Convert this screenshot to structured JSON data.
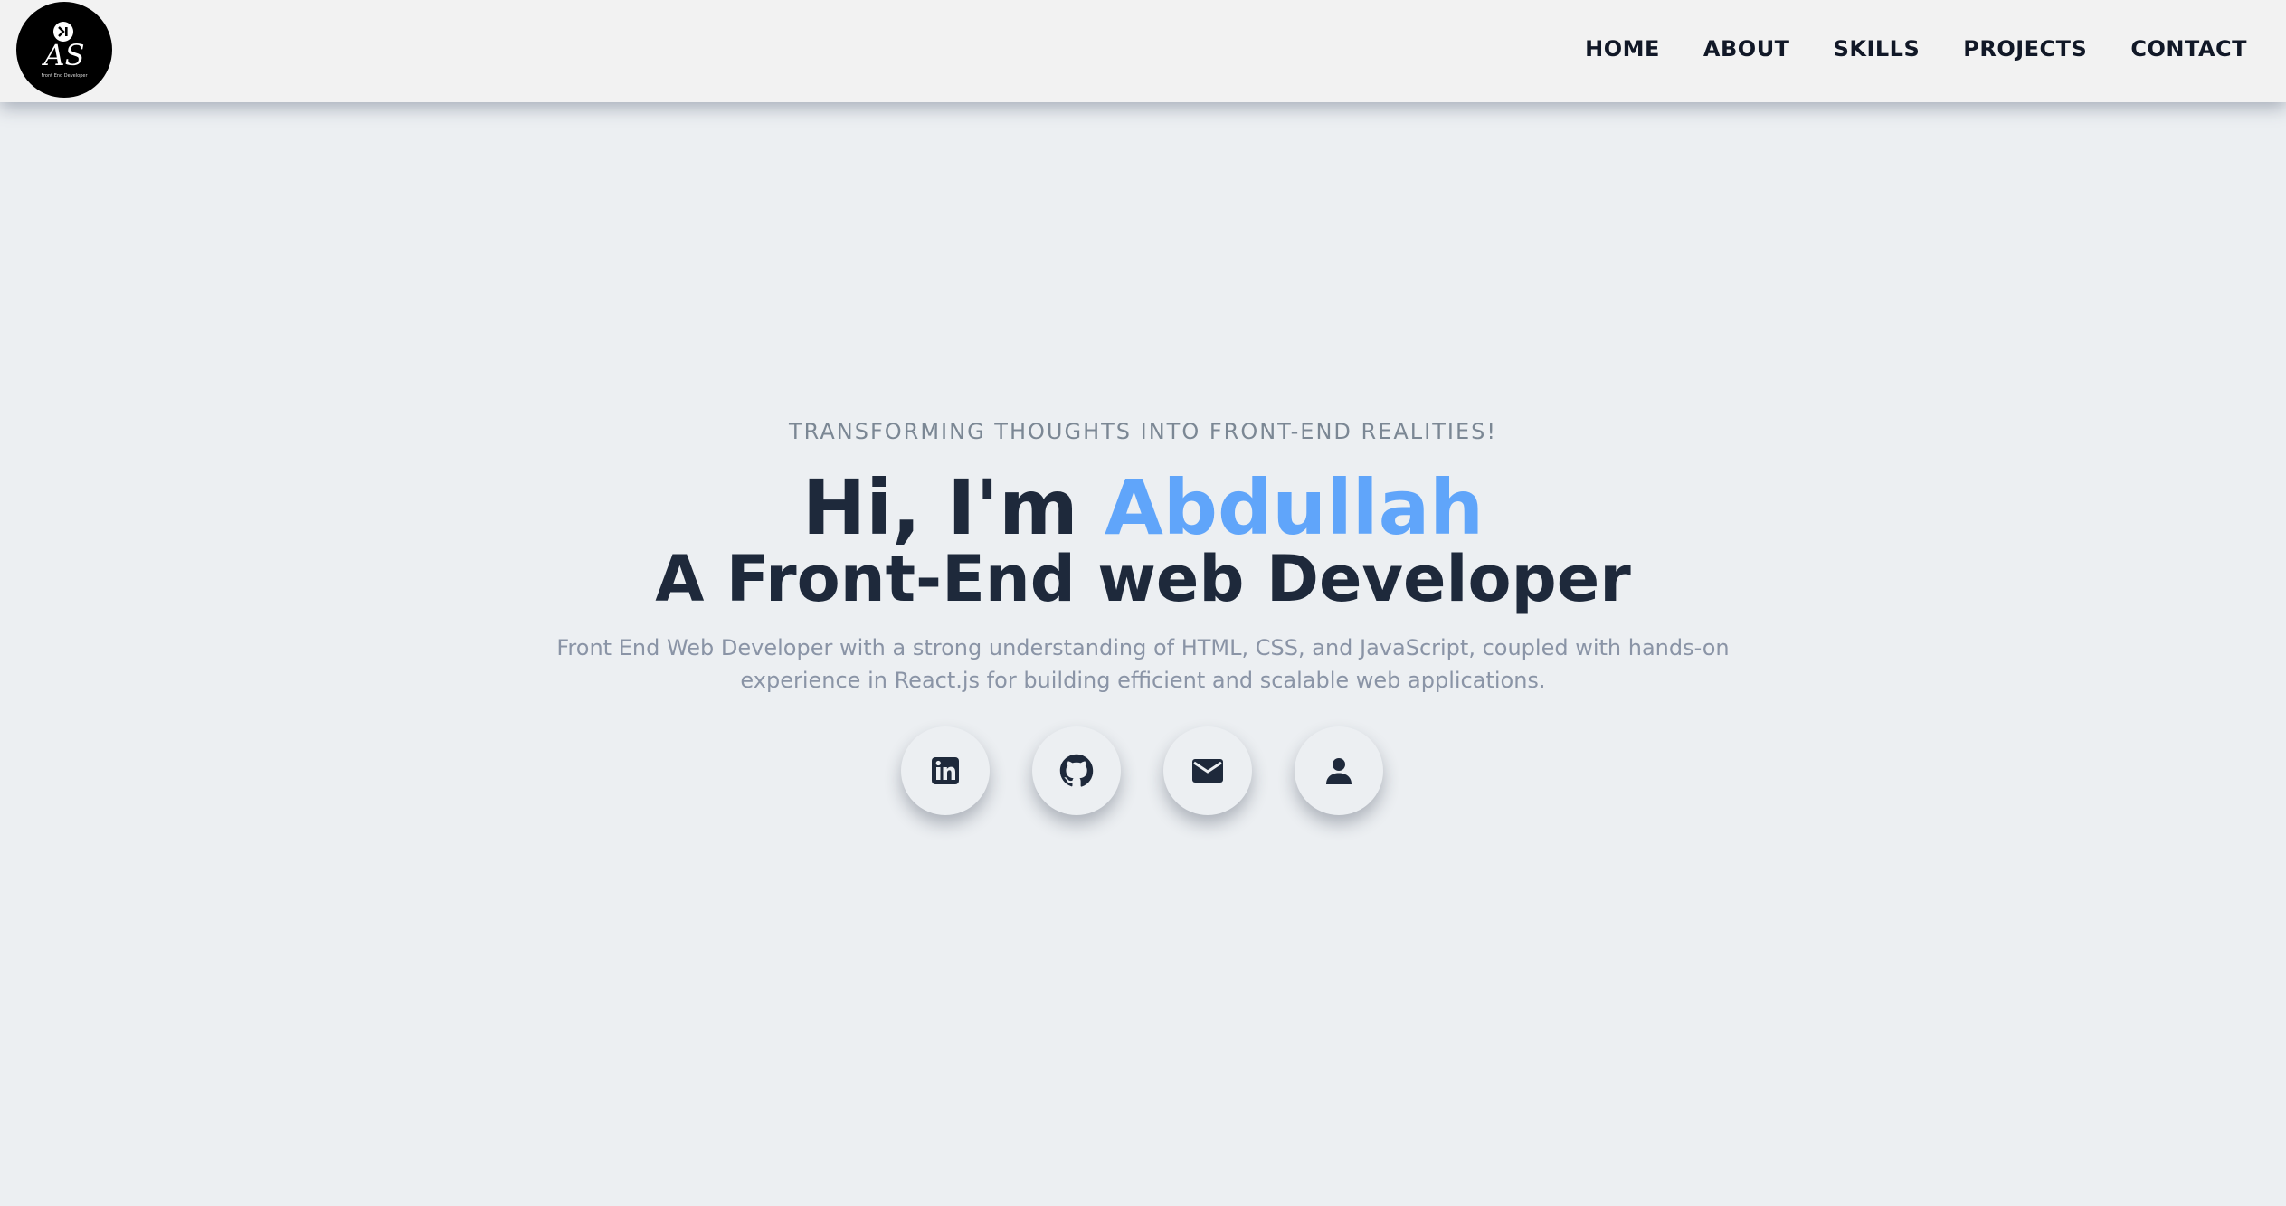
{
  "logo": {
    "initials": "AS",
    "subtitle": "Front End Developer",
    "icon": "chevron-right-icon"
  },
  "nav": {
    "items": [
      {
        "label": "HOME"
      },
      {
        "label": "ABOUT"
      },
      {
        "label": "SKILLS"
      },
      {
        "label": "PROJECTS"
      },
      {
        "label": "CONTACT"
      }
    ]
  },
  "hero": {
    "tagline": "TRANSFORMING THOUGHTS INTO FRONT-END REALITIES!",
    "greeting": "Hi, I'm ",
    "name": "Abdullah",
    "role": "A Front-End web Developer",
    "description": "Front End Web Developer with a strong understanding of HTML, CSS, and JavaScript, coupled with hands-on experience in React.js for building efficient and scalable web applications."
  },
  "socials": [
    {
      "icon": "linkedin-icon"
    },
    {
      "icon": "github-icon"
    },
    {
      "icon": "mail-icon"
    },
    {
      "icon": "user-icon"
    }
  ],
  "colors": {
    "background": "#eceff2",
    "navbar": "#f2f2f2",
    "text_dark": "#1e293b",
    "accent": "#60a5fa",
    "muted": "#8a94a6"
  }
}
